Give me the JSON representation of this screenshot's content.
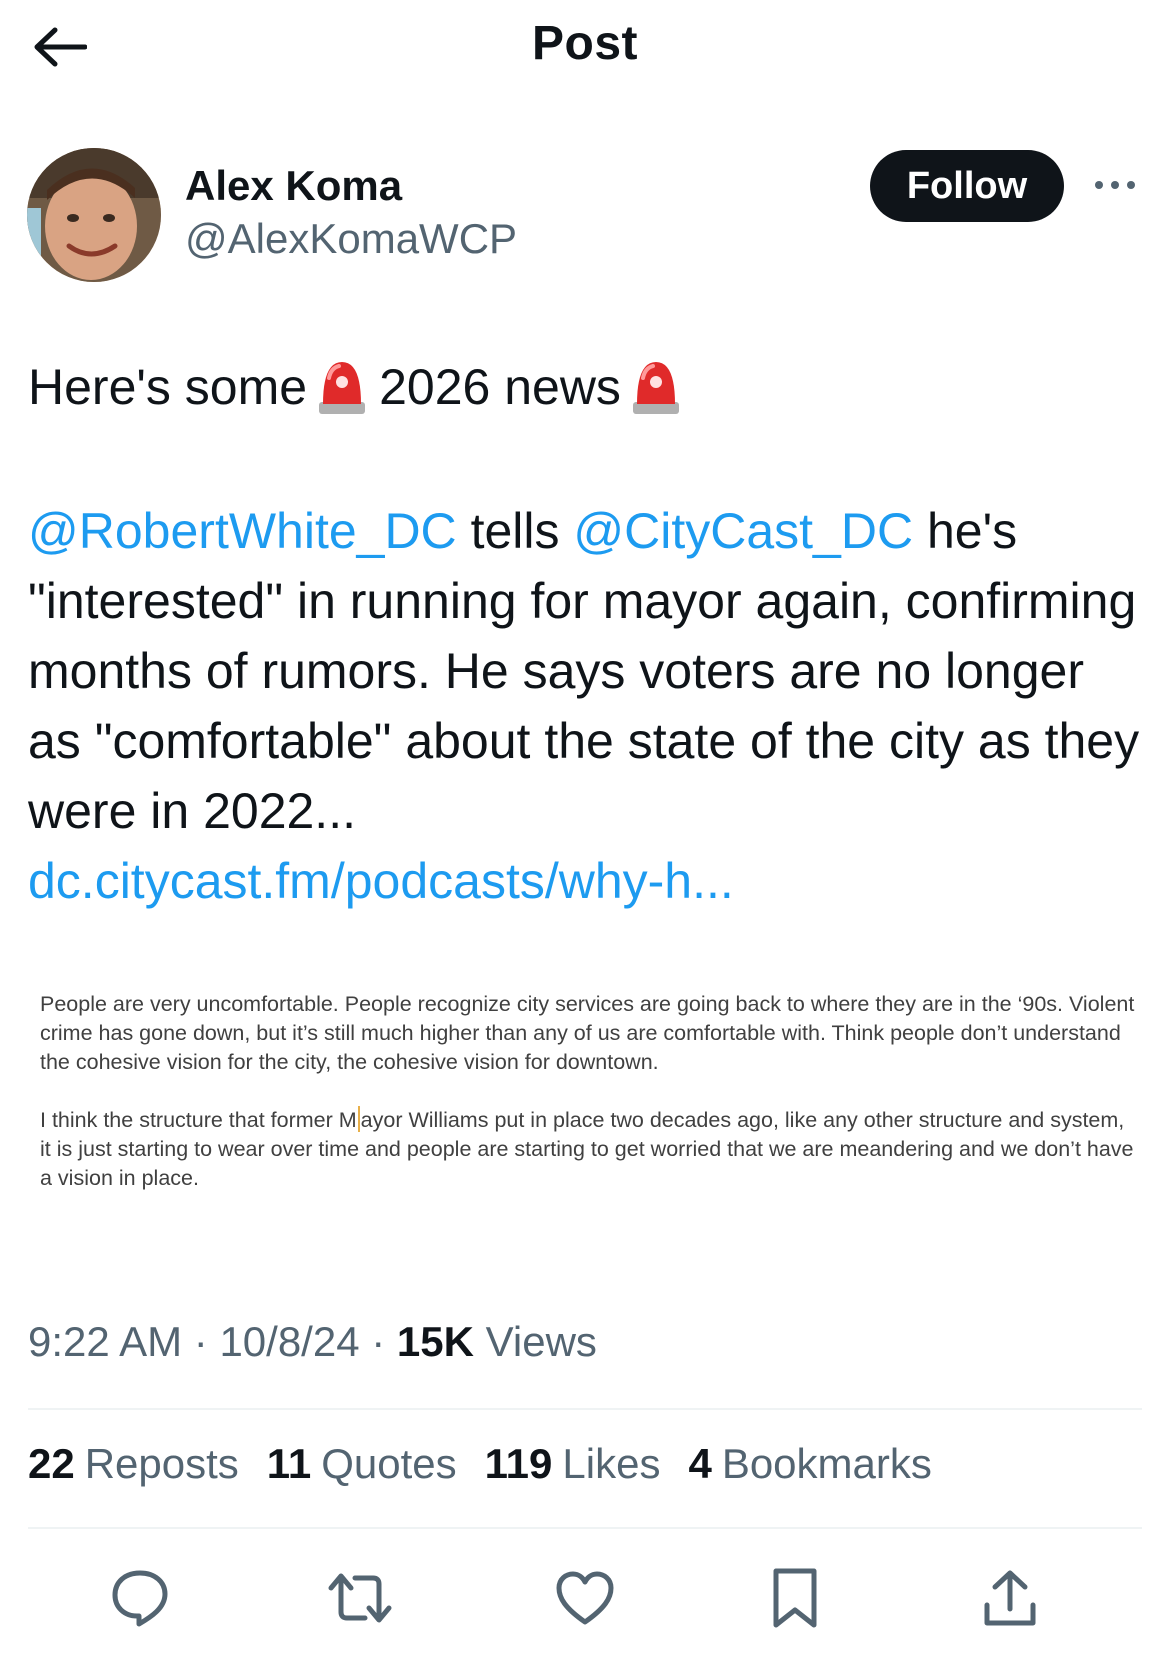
{
  "topbar": {
    "title": "Post",
    "back_icon": "arrow-left-icon"
  },
  "author": {
    "display_name": "Alex Koma",
    "handle": "@AlexKomaWCP",
    "follow_label": "Follow",
    "more_icon": "more-horizontal-icon"
  },
  "post": {
    "headline_part1": "Here's some",
    "headline_part2": "2026 news",
    "emoji_icon": "police-light-emoji",
    "mention1": "@RobertWhite_DC",
    "text_tells": " tells ",
    "mention2": "@CityCast_DC",
    "text_main": " he's \"interested\" in running for mayor again, confirming months of rumors. He says voters are no longer as \"comfortable\" about the state of the city as they were in 2022...",
    "link": "dc.citycast.fm/podcasts/why-h..."
  },
  "quote_image": {
    "paragraph1": "People are very uncomfortable. People recognize city services are going back to where they are in the ‘90s. Violent crime has gone down, but it’s still much higher than any of us are comfortable with. Think people don’t understand the cohesive vision for the city, the cohesive vision for downtown.",
    "paragraph2_before": "I think the structure that former M",
    "paragraph2_after": "ayor Williams put in place two decades ago, like any other structure and system, it is just starting to wear over time and people are starting to get worried that we are meandering and we don’t have a vision in place."
  },
  "meta": {
    "time": "9:22 AM",
    "sep": " · ",
    "date": "10/8/24",
    "views_count": "15K",
    "views_label": " Views"
  },
  "stats": [
    {
      "count": "22",
      "label": "Reposts"
    },
    {
      "count": "11",
      "label": "Quotes"
    },
    {
      "count": "119",
      "label": "Likes"
    },
    {
      "count": "4",
      "label": "Bookmarks"
    }
  ],
  "actions": {
    "reply_icon": "reply-icon",
    "repost_icon": "repost-icon",
    "like_icon": "heart-icon",
    "bookmark_icon": "bookmark-icon",
    "share_icon": "share-icon"
  },
  "colors": {
    "link": "#1d9bf0",
    "text": "#0f1419",
    "secondary": "#536471"
  }
}
